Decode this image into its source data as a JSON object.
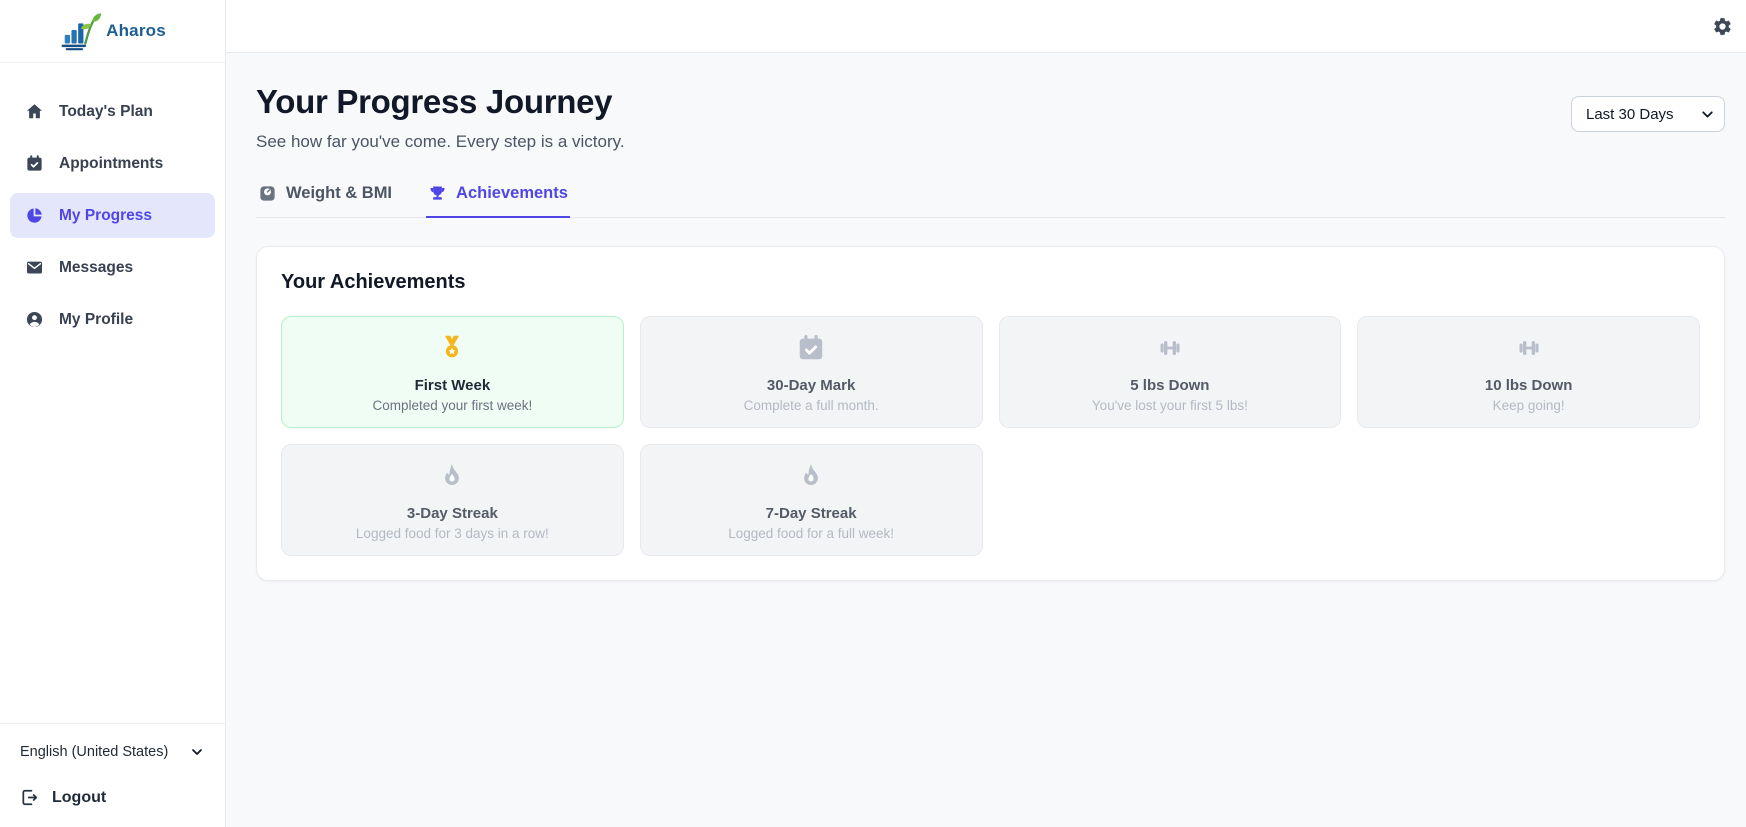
{
  "app": {
    "brand": "Aharos"
  },
  "sidebar": {
    "items": [
      {
        "label": "Today's Plan",
        "icon": "home",
        "active": false
      },
      {
        "label": "Appointments",
        "icon": "calendar-check",
        "active": false
      },
      {
        "label": "My Progress",
        "icon": "pie-chart",
        "active": true
      },
      {
        "label": "Messages",
        "icon": "mail",
        "active": false
      },
      {
        "label": "My Profile",
        "icon": "user-circle",
        "active": false
      }
    ],
    "language": "English (United States)",
    "logout_label": "Logout"
  },
  "header": {
    "title": "Your Progress Journey",
    "subtitle": "See how far you've come. Every step is a victory.",
    "range_selector": {
      "selected": "Last 30 Days"
    }
  },
  "tabs": [
    {
      "label": "Weight & BMI",
      "icon": "scale",
      "active": false
    },
    {
      "label": "Achievements",
      "icon": "trophy",
      "active": true
    }
  ],
  "achievements": {
    "section_title": "Your Achievements",
    "cards": [
      {
        "title": "First Week",
        "description": "Completed your first week!",
        "icon": "medal",
        "unlocked": true
      },
      {
        "title": "30-Day Mark",
        "description": "Complete a full month.",
        "icon": "calendar-check",
        "unlocked": false
      },
      {
        "title": "5 lbs Down",
        "description": "You've lost your first 5 lbs!",
        "icon": "dumbbell",
        "unlocked": false
      },
      {
        "title": "10 lbs Down",
        "description": "Keep going!",
        "icon": "dumbbell",
        "unlocked": false
      },
      {
        "title": "3-Day Streak",
        "description": "Logged food for 3 days in a row!",
        "icon": "flame",
        "unlocked": false
      },
      {
        "title": "7-Day Streak",
        "description": "Logged food for a full week!",
        "icon": "flame",
        "unlocked": false
      }
    ]
  },
  "colors": {
    "accent": "#4f46e5",
    "accent_bg": "#e4e6fb",
    "unlocked_bg": "#f0fdf4",
    "unlocked_border": "#b5f0cb",
    "medal_gold": "#f4b51d",
    "locked_bg": "#f3f4f6",
    "content_bg": "#f8f9fb"
  }
}
